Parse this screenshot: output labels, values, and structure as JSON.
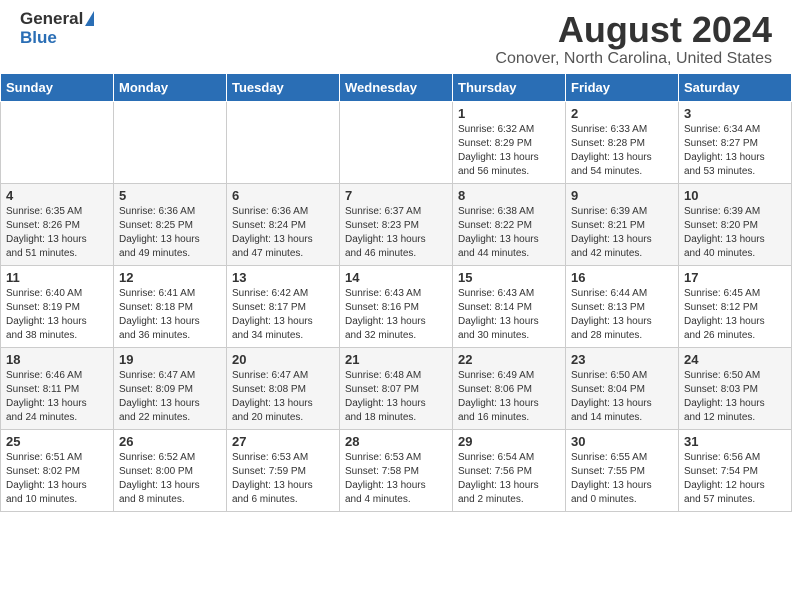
{
  "header": {
    "logo_general": "General",
    "logo_blue": "Blue",
    "title": "August 2024",
    "subtitle": "Conover, North Carolina, United States"
  },
  "days_of_week": [
    "Sunday",
    "Monday",
    "Tuesday",
    "Wednesday",
    "Thursday",
    "Friday",
    "Saturday"
  ],
  "weeks": [
    [
      {
        "num": "",
        "info": ""
      },
      {
        "num": "",
        "info": ""
      },
      {
        "num": "",
        "info": ""
      },
      {
        "num": "",
        "info": ""
      },
      {
        "num": "1",
        "info": "Sunrise: 6:32 AM\nSunset: 8:29 PM\nDaylight: 13 hours\nand 56 minutes."
      },
      {
        "num": "2",
        "info": "Sunrise: 6:33 AM\nSunset: 8:28 PM\nDaylight: 13 hours\nand 54 minutes."
      },
      {
        "num": "3",
        "info": "Sunrise: 6:34 AM\nSunset: 8:27 PM\nDaylight: 13 hours\nand 53 minutes."
      }
    ],
    [
      {
        "num": "4",
        "info": "Sunrise: 6:35 AM\nSunset: 8:26 PM\nDaylight: 13 hours\nand 51 minutes."
      },
      {
        "num": "5",
        "info": "Sunrise: 6:36 AM\nSunset: 8:25 PM\nDaylight: 13 hours\nand 49 minutes."
      },
      {
        "num": "6",
        "info": "Sunrise: 6:36 AM\nSunset: 8:24 PM\nDaylight: 13 hours\nand 47 minutes."
      },
      {
        "num": "7",
        "info": "Sunrise: 6:37 AM\nSunset: 8:23 PM\nDaylight: 13 hours\nand 46 minutes."
      },
      {
        "num": "8",
        "info": "Sunrise: 6:38 AM\nSunset: 8:22 PM\nDaylight: 13 hours\nand 44 minutes."
      },
      {
        "num": "9",
        "info": "Sunrise: 6:39 AM\nSunset: 8:21 PM\nDaylight: 13 hours\nand 42 minutes."
      },
      {
        "num": "10",
        "info": "Sunrise: 6:39 AM\nSunset: 8:20 PM\nDaylight: 13 hours\nand 40 minutes."
      }
    ],
    [
      {
        "num": "11",
        "info": "Sunrise: 6:40 AM\nSunset: 8:19 PM\nDaylight: 13 hours\nand 38 minutes."
      },
      {
        "num": "12",
        "info": "Sunrise: 6:41 AM\nSunset: 8:18 PM\nDaylight: 13 hours\nand 36 minutes."
      },
      {
        "num": "13",
        "info": "Sunrise: 6:42 AM\nSunset: 8:17 PM\nDaylight: 13 hours\nand 34 minutes."
      },
      {
        "num": "14",
        "info": "Sunrise: 6:43 AM\nSunset: 8:16 PM\nDaylight: 13 hours\nand 32 minutes."
      },
      {
        "num": "15",
        "info": "Sunrise: 6:43 AM\nSunset: 8:14 PM\nDaylight: 13 hours\nand 30 minutes."
      },
      {
        "num": "16",
        "info": "Sunrise: 6:44 AM\nSunset: 8:13 PM\nDaylight: 13 hours\nand 28 minutes."
      },
      {
        "num": "17",
        "info": "Sunrise: 6:45 AM\nSunset: 8:12 PM\nDaylight: 13 hours\nand 26 minutes."
      }
    ],
    [
      {
        "num": "18",
        "info": "Sunrise: 6:46 AM\nSunset: 8:11 PM\nDaylight: 13 hours\nand 24 minutes."
      },
      {
        "num": "19",
        "info": "Sunrise: 6:47 AM\nSunset: 8:09 PM\nDaylight: 13 hours\nand 22 minutes."
      },
      {
        "num": "20",
        "info": "Sunrise: 6:47 AM\nSunset: 8:08 PM\nDaylight: 13 hours\nand 20 minutes."
      },
      {
        "num": "21",
        "info": "Sunrise: 6:48 AM\nSunset: 8:07 PM\nDaylight: 13 hours\nand 18 minutes."
      },
      {
        "num": "22",
        "info": "Sunrise: 6:49 AM\nSunset: 8:06 PM\nDaylight: 13 hours\nand 16 minutes."
      },
      {
        "num": "23",
        "info": "Sunrise: 6:50 AM\nSunset: 8:04 PM\nDaylight: 13 hours\nand 14 minutes."
      },
      {
        "num": "24",
        "info": "Sunrise: 6:50 AM\nSunset: 8:03 PM\nDaylight: 13 hours\nand 12 minutes."
      }
    ],
    [
      {
        "num": "25",
        "info": "Sunrise: 6:51 AM\nSunset: 8:02 PM\nDaylight: 13 hours\nand 10 minutes."
      },
      {
        "num": "26",
        "info": "Sunrise: 6:52 AM\nSunset: 8:00 PM\nDaylight: 13 hours\nand 8 minutes."
      },
      {
        "num": "27",
        "info": "Sunrise: 6:53 AM\nSunset: 7:59 PM\nDaylight: 13 hours\nand 6 minutes."
      },
      {
        "num": "28",
        "info": "Sunrise: 6:53 AM\nSunset: 7:58 PM\nDaylight: 13 hours\nand 4 minutes."
      },
      {
        "num": "29",
        "info": "Sunrise: 6:54 AM\nSunset: 7:56 PM\nDaylight: 13 hours\nand 2 minutes."
      },
      {
        "num": "30",
        "info": "Sunrise: 6:55 AM\nSunset: 7:55 PM\nDaylight: 13 hours\nand 0 minutes."
      },
      {
        "num": "31",
        "info": "Sunrise: 6:56 AM\nSunset: 7:54 PM\nDaylight: 12 hours\nand 57 minutes."
      }
    ]
  ]
}
